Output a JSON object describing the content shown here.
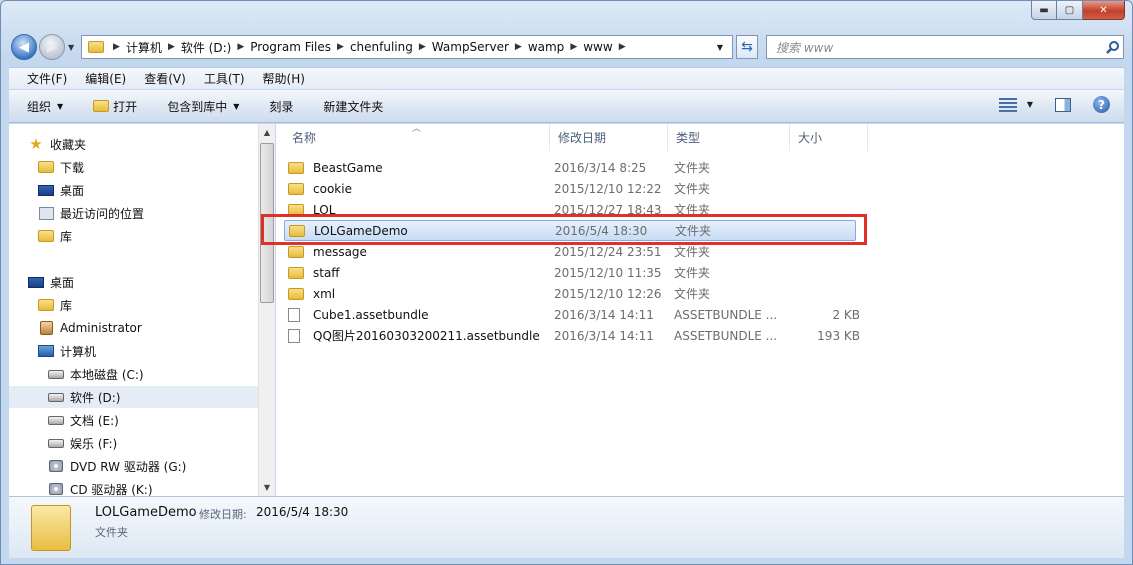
{
  "caption": {
    "minimize": "▬",
    "maximize": "▢",
    "close": "✕"
  },
  "nav": {
    "breadcrumbs": [
      "计算机",
      "软件 (D:)",
      "Program Files",
      "chenfuling",
      "WampServer",
      "wamp",
      "www"
    ],
    "search_placeholder": "搜索 www"
  },
  "menu": [
    "文件(F)",
    "编辑(E)",
    "查看(V)",
    "工具(T)",
    "帮助(H)"
  ],
  "toolbar": {
    "organize": "组织",
    "open": "打开",
    "include_in_library": "包含到库中",
    "burn": "刻录",
    "new_folder": "新建文件夹"
  },
  "sidebar": {
    "favorites": [
      {
        "label": "收藏夹",
        "icon": "star-icon"
      },
      {
        "label": "下载",
        "icon": "folder-icon"
      },
      {
        "label": "桌面",
        "icon": "desktop-icon"
      },
      {
        "label": "最近访问的位置",
        "icon": "recent-places-icon"
      },
      {
        "label": "库",
        "icon": "library-icon"
      }
    ],
    "tree": [
      {
        "label": "桌面",
        "icon": "desktop-icon"
      },
      {
        "label": "库",
        "icon": "library-icon"
      },
      {
        "label": "Administrator",
        "icon": "user-folder-icon"
      },
      {
        "label": "计算机",
        "icon": "computer-icon"
      },
      {
        "label": "本地磁盘 (C:)",
        "icon": "drive-icon"
      },
      {
        "label": "软件 (D:)",
        "icon": "drive-icon",
        "selected": true
      },
      {
        "label": "文档 (E:)",
        "icon": "drive-icon"
      },
      {
        "label": "娱乐 (F:)",
        "icon": "drive-icon"
      },
      {
        "label": "DVD RW 驱动器 (G:)",
        "icon": "dvd-drive-icon"
      },
      {
        "label": "CD 驱动器 (K:)",
        "icon": "cd-drive-icon"
      }
    ]
  },
  "columns": {
    "name": "名称",
    "date": "修改日期",
    "type": "类型",
    "size": "大小"
  },
  "files": [
    {
      "name": "BeastGame",
      "date": "2016/3/14 8:25",
      "type": "文件夹",
      "size": "",
      "icon": "folder-icon"
    },
    {
      "name": "cookie",
      "date": "2015/12/10 12:22",
      "type": "文件夹",
      "size": "",
      "icon": "folder-icon"
    },
    {
      "name": "LOL",
      "date": "2015/12/27 18:43",
      "type": "文件夹",
      "size": "",
      "icon": "folder-icon"
    },
    {
      "name": "LOLGameDemo",
      "date": "2016/5/4 18:30",
      "type": "文件夹",
      "size": "",
      "icon": "folder-icon",
      "selected": true
    },
    {
      "name": "message",
      "date": "2015/12/24 23:51",
      "type": "文件夹",
      "size": "",
      "icon": "folder-icon"
    },
    {
      "name": "staff",
      "date": "2015/12/10 11:35",
      "type": "文件夹",
      "size": "",
      "icon": "folder-icon"
    },
    {
      "name": "xml",
      "date": "2015/12/10 12:26",
      "type": "文件夹",
      "size": "",
      "icon": "folder-icon"
    },
    {
      "name": "Cube1.assetbundle",
      "date": "2016/3/14 14:11",
      "type": "ASSETBUNDLE ...",
      "size": "2 KB",
      "icon": "file-icon"
    },
    {
      "name": "QQ图片20160303200211.assetbundle",
      "date": "2016/3/14 14:11",
      "type": "ASSETBUNDLE ...",
      "size": "193 KB",
      "icon": "file-icon"
    }
  ],
  "details": {
    "name": "LOLGameDemo",
    "date_label": "修改日期:",
    "date_value": "2016/5/4 18:30",
    "type": "文件夹"
  },
  "colors": {
    "highlight": "#e0302a",
    "selection": "#c7dcf5"
  }
}
